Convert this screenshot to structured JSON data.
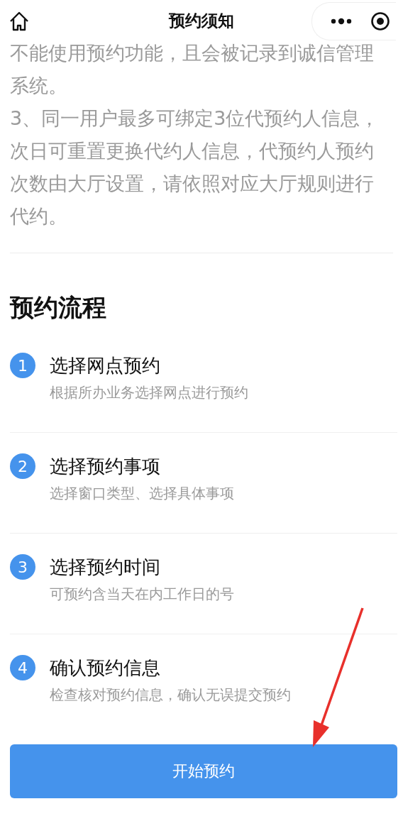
{
  "nav_bar": {
    "title": "预约须知"
  },
  "notice": {
    "paragraphs": [
      "不能使用预约功能，且会被记录到诚信管理系统。",
      "3、同一用户最多可绑定3位代预约人信息，次日可重置更换代约人信息，代预约人预约次数由大厅设置，请依照对应大厅规则进行代约。"
    ]
  },
  "process": {
    "heading": "预约流程",
    "steps": [
      {
        "number": "1",
        "title": "选择网点预约",
        "description": "根据所办业务选择网点进行预约"
      },
      {
        "number": "2",
        "title": "选择预约事项",
        "description": "选择窗口类型、选择具体事项"
      },
      {
        "number": "3",
        "title": "选择预约时间",
        "description": "可预约含当天在内工作日的号"
      },
      {
        "number": "4",
        "title": "确认预约信息",
        "description": "检查核对预约信息，确认无误提交预约"
      }
    ]
  },
  "start_button": {
    "label": "开始预约"
  }
}
